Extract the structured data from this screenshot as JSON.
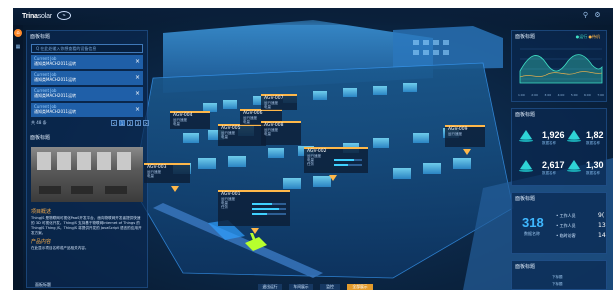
{
  "header": {
    "brand_bold": "Trina",
    "brand_light": "solar",
    "brand_badge": "Ts"
  },
  "left_panel": {
    "title": "面板标题",
    "search_placeholder": "Q 在此处输入你想查看的设备信息",
    "notices": [
      {
        "line1": "Current Job",
        "line2": "通知类MACH2011运转"
      },
      {
        "line1": "Current Job",
        "line2": "通知类MACH2011运转"
      },
      {
        "line1": "Current Job",
        "line2": "通知类MACH2011运转"
      },
      {
        "line1": "Current Job",
        "line2": "通知类MACH2011运转"
      }
    ],
    "pager_total": "共 48 条",
    "pager_pages": [
      "<",
      "1",
      "2",
      "3",
      ">"
    ],
    "panel2_title": "面板标题",
    "section1": "项目概述",
    "para1": "ThingJS 是物联网可视化PaaS开发平台，面向物联网开发者提供快速的 3D 可视化开发。ThingJS 支持基于物联网Internet of Things 的ThingJS Thing JS。ThingJS 将提供开发的 JavaScript 语言的应用开发方案。",
    "section2": "产品内容",
    "para2": "在此显示项目名称或产品相关内容。"
  },
  "agv_cards": [
    {
      "name": "AGV-001",
      "rows": [
        "运行速度",
        "电量",
        "任务"
      ]
    },
    {
      "name": "AGV-002",
      "rows": [
        "运行速度",
        "电量",
        "任务"
      ]
    },
    {
      "name": "AGV-003",
      "rows": [
        "运行速度",
        "电量"
      ]
    },
    {
      "name": "AGV-004",
      "rows": [
        "运行速度",
        "电量"
      ]
    },
    {
      "name": "AGV-005",
      "rows": [
        "运行速度",
        "电量"
      ]
    },
    {
      "name": "AGV-006",
      "rows": [
        "运行速度",
        "电量"
      ]
    },
    {
      "name": "AGV-007",
      "rows": [
        "运行速度",
        "电量"
      ]
    },
    {
      "name": "AGV-008",
      "rows": [
        "运行速度",
        "电量"
      ]
    },
    {
      "name": "AGV-009",
      "rows": [
        "运行速度"
      ]
    }
  ],
  "right_panels": {
    "chart_title": "面板标题",
    "legend": [
      "●运行",
      "●待机"
    ],
    "chart_ticks": [
      "1:00",
      "2:00",
      "3:00",
      "4:00",
      "5:00",
      "6:00",
      "7:00"
    ],
    "stats_title": "面板标题",
    "stats": [
      {
        "value": "1,926",
        "label": "数据名称"
      },
      {
        "value": "1,82",
        "label": "数据名称"
      },
      {
        "value": "2,617",
        "label": "数据名称"
      },
      {
        "value": "1,30",
        "label": "数据名称"
      }
    ],
    "people_title": "面板标题",
    "people_total": "318",
    "people_total_label": "数据名称",
    "people_rows": [
      {
        "label": "工作人员",
        "value": "9("
      },
      {
        "label": "工作人员",
        "value": "13"
      },
      {
        "label": "临时访客",
        "value": "14"
      }
    ],
    "extra_title": "面板标题",
    "extra_small": "下标题",
    "extra_small2": "下标题"
  },
  "bottom_bar": {
    "tabs": [
      "退出运行",
      "车间展示",
      "监控",
      "全部展示"
    ],
    "active_index": 3
  },
  "footer_label": "面板标题"
}
